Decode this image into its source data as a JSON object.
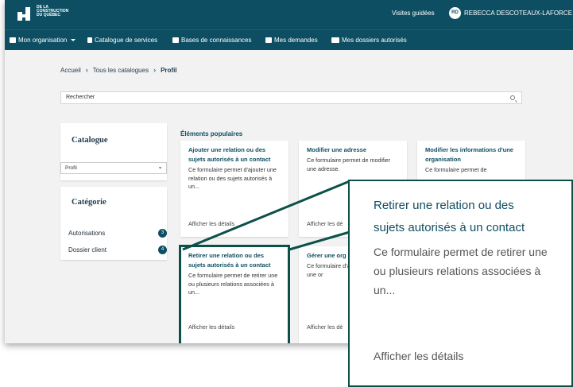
{
  "header": {
    "logo_text": "DE LA CONSTRUCTION DU QUÉBEC",
    "visites_label": "Visites guidées",
    "user_initials": "RD",
    "user_name": "REBECCA DESCOTEAUX-LAFORCE"
  },
  "nav": {
    "items": [
      {
        "label": "Mon organisation",
        "icon": "briefcase-icon"
      },
      {
        "label": "Catalogue de services",
        "icon": "document-icon"
      },
      {
        "label": "Bases de connaissances",
        "icon": "book-icon"
      },
      {
        "label": "Mes demandes",
        "icon": "list-icon"
      },
      {
        "label": "Mes dossiers autorisés",
        "icon": "users-icon"
      }
    ]
  },
  "breadcrumb": {
    "items": [
      "Accueil",
      "Tous les catalogues",
      "Profil"
    ]
  },
  "search": {
    "placeholder": "Rechercher"
  },
  "sidebar": {
    "catalogue_heading": "Catalogue",
    "catalogue_selected": "Profil",
    "categorie_heading": "Catégorie",
    "categories": [
      {
        "label": "Autorisations",
        "count": "3"
      },
      {
        "label": "Dossier client",
        "count": "4"
      }
    ]
  },
  "popular": {
    "title": "Éléments populaires",
    "cards": [
      {
        "title": "Ajouter une relation ou des sujets autorisés à un contact",
        "desc": "Ce formulaire permet d'ajouter une relation ou des sujets autorisés à un...",
        "link": "Afficher les détails"
      },
      {
        "title": "Modifier une adresse",
        "desc": "Ce formulaire permet de modifier une adresse.",
        "link": "Afficher les dé"
      },
      {
        "title": "Modifier les informations d'une organisation",
        "desc": "Ce formulaire permet de",
        "link": ""
      },
      {
        "title": "Retirer une relation ou des sujets autorisés à un contact",
        "desc": "Ce formulaire permet de retirer une ou plusieurs relations associées à un...",
        "link": "Afficher les détails"
      },
      {
        "title": "Gérer une org autorisée à u",
        "desc": "Ce formulaire d'ajouter, de retirer une or",
        "link": "Afficher les dé"
      }
    ]
  },
  "zoom": {
    "title": "Retirer une relation ou des sujets autorisés à un contact",
    "desc": "Ce formulaire permet de retirer une ou plusieurs relations associées à un...",
    "link": "Afficher les détails"
  },
  "colors": {
    "header_bg": "#0d4e63",
    "highlight_border": "#0c5149",
    "page_bg": "#f2f2f2"
  }
}
